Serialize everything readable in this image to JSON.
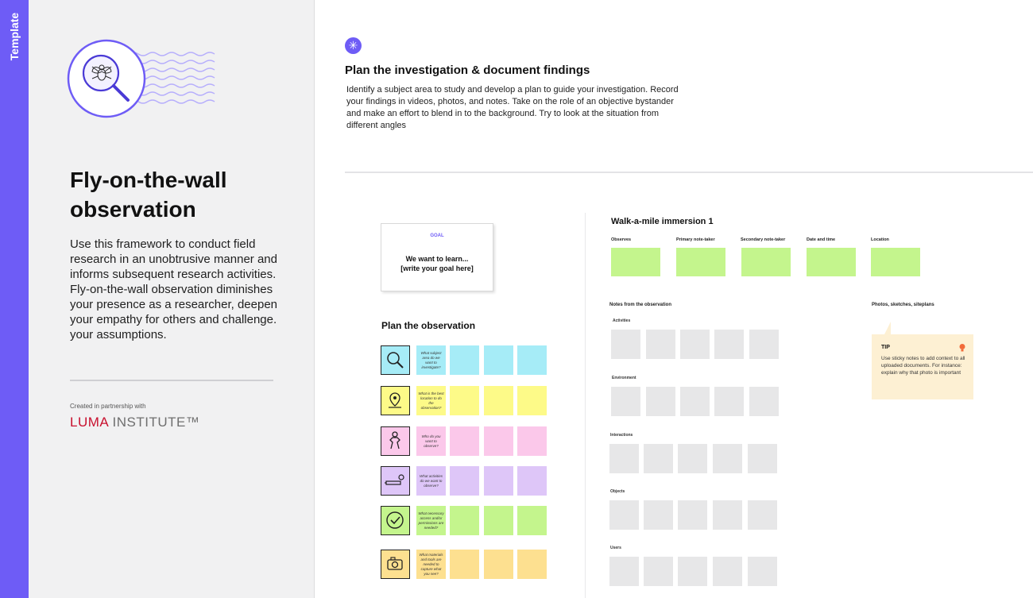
{
  "sidebar_tab": {
    "label": "Template"
  },
  "template": {
    "title": "Fly-on-the-wall observation",
    "description": "Use this framework to conduct field research in an unobtrusive manner and informs subsequent research activities. Fly-on-the-wall observation diminishes your presence as a researcher, deepen your empathy for others and challenge. your assumptions.",
    "partner_caption": "Created in partnership with",
    "partner_logo_luma": "LUMA",
    "partner_logo_institute": " INSTITUTE™"
  },
  "board": {
    "section_title": "Plan the investigation & document findings",
    "section_description": "Identify a subject area to study and develop a plan to guide your investigation. Record your findings in videos, photos, and notes. Take on the role of an objective bystander and make an effort to blend in to the background. Try to look at the situation from different angles",
    "goal_card": {
      "label": "GOAL",
      "line1": "We want to learn...",
      "line2": "[write your goal here]"
    },
    "plan_heading": "Plan the observation",
    "plan_rows": [
      {
        "icon": "magnifier-icon",
        "prompt": "What subject area do we want to investigate?",
        "color": "#a6ecf7"
      },
      {
        "icon": "location-pin-icon",
        "prompt": "What is the best location to do the observation?",
        "color": "#fdfa88"
      },
      {
        "icon": "person-icon",
        "prompt": "Who do you want to observe?",
        "color": "#fbc8ea"
      },
      {
        "icon": "activity-tools-icon",
        "prompt": "What activities do we want to observe?",
        "color": "#dec6f8"
      },
      {
        "icon": "checkmark-badge-icon",
        "prompt": "What necessary access and/or permissions are needed?",
        "color": "#c4f58d"
      },
      {
        "icon": "camera-icon",
        "prompt": "What materials and tools are needed to capture what you see?",
        "color": "#fde090"
      }
    ],
    "immersion": {
      "title": "Walk-a-mile immersion 1",
      "fields": [
        "Observes",
        "Primary note-taker",
        "Secondary note-taker",
        "Date and time",
        "Location"
      ],
      "field_color": "#c4f58d",
      "notes_label": "Notes from the observation",
      "photos_label": "Photos, sketches, siteplans",
      "categories": [
        "Activities",
        "Environment",
        "Interactions",
        "Objects",
        "Users"
      ]
    },
    "tip": {
      "title": "TIP",
      "text": "Use sticky notes to add context to all uploaded documents. For instance: explain why that photo is important"
    }
  },
  "colors": {
    "accent": "#6e5cf6",
    "luma_red": "#c8102e",
    "tip_bg": "#fdf0d3"
  }
}
